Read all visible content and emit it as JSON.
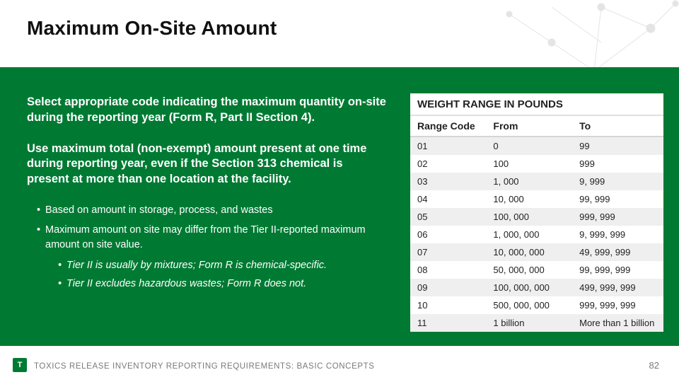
{
  "title": "Maximum On-Site Amount",
  "left": {
    "p1": "Select appropriate code indicating the maximum quantity on-site during the reporting year (Form R, Part II Section 4).",
    "p2": "Use maximum total (non-exempt) amount present at one time during reporting year, even if the Section 313 chemical is present at more than one location at the facility.",
    "bullets": [
      "Based on amount in storage, process, and wastes",
      "Maximum amount on site may differ from the Tier II-reported maximum amount on site value."
    ],
    "subbullets": [
      "Tier II is usually by mixtures; Form R is chemical-specific.",
      "Tier II excludes hazardous wastes; Form R does not."
    ]
  },
  "table": {
    "caption": "WEIGHT RANGE IN POUNDS",
    "cols": [
      "Range Code",
      "From",
      "To"
    ],
    "rows": [
      [
        "01",
        "0",
        "99"
      ],
      [
        "02",
        "100",
        "999"
      ],
      [
        "03",
        "1, 000",
        "9, 999"
      ],
      [
        "04",
        "10, 000",
        "99, 999"
      ],
      [
        "05",
        "100, 000",
        "999, 999"
      ],
      [
        "06",
        "1, 000, 000",
        "9, 999, 999"
      ],
      [
        "07",
        "10, 000, 000",
        "49, 999, 999"
      ],
      [
        "08",
        "50, 000, 000",
        "99, 999, 999"
      ],
      [
        "09",
        "100, 000, 000",
        "499, 999, 999"
      ],
      [
        "10",
        "500, 000, 000",
        "999, 999, 999"
      ],
      [
        "11",
        "1 billion",
        "More than 1 billion"
      ]
    ]
  },
  "footer": {
    "icon_letter": "T",
    "text_prefix": "TOXICS RELEASE INVENTORY REPORTING REQUIREMENTS",
    "text_suffix": ": BASIC CONCEPTS",
    "page": "82"
  }
}
